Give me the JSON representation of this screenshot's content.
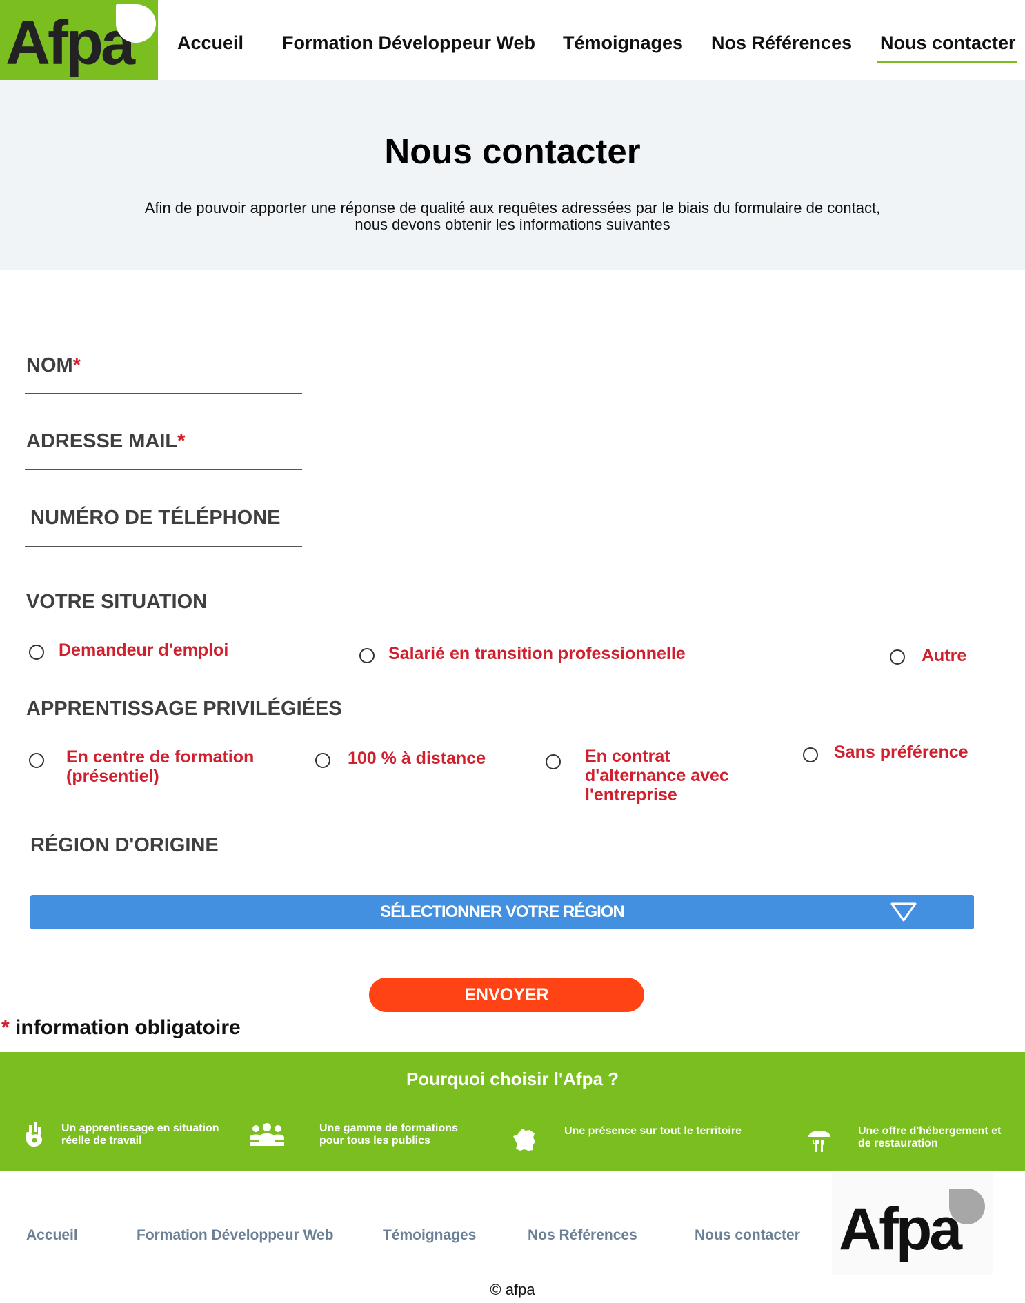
{
  "header": {
    "logo_text": "Afpa",
    "nav": [
      "Accueil",
      "Formation Développeur Web",
      "Témoignages",
      "Nos Références",
      "Nous contacter"
    ],
    "active_nav": "Nous contacter"
  },
  "hero": {
    "title": "Nous contacter",
    "subtitle_line1": "Afin de pouvoir apporter une réponse de qualité aux requêtes adressées par le biais du formulaire de contact,",
    "subtitle_line2": "nous devons obtenir les informations suivantes"
  },
  "form": {
    "nom_label": "NOM",
    "mail_label": "ADRESSE MAIL",
    "tel_label": "NUMÉRO DE TÉLÉPHONE",
    "required_mark": "*",
    "situation_label": "VOTRE SITUATION",
    "situation_options": [
      "Demandeur d'emploi",
      "Salarié en transition professionnelle",
      "Autre"
    ],
    "apprentissage_label": "APPRENTISSAGE PRIVILÉGIÉES",
    "apprentissage_options": [
      "En centre de formation (présentiel)",
      "100 % à distance",
      "En contrat d'alternance avec l'entreprise",
      "Sans préférence"
    ],
    "region_label": "RÉGION D'ORIGINE",
    "region_select": "SÉLECTIONNER VOTRE RÉGION",
    "submit_label": "ENVOYER",
    "mandatory_note": "information obligatoire"
  },
  "why": {
    "title": "Pourquoi choisir l'Afpa ?",
    "features": [
      {
        "icon": "hand-ok-icon",
        "text": "Un apprentissage en situation réelle de travail"
      },
      {
        "icon": "people-group-icon",
        "text": "Une gamme de formations pour tous les publics"
      },
      {
        "icon": "france-map-icon",
        "text": "Une présence sur tout le territoire"
      },
      {
        "icon": "restaurant-icon",
        "text": "Une offre d'hébergement et de restauration"
      }
    ]
  },
  "footer": {
    "links": [
      "Accueil",
      "Formation Développeur Web",
      "Témoignages",
      "Nos Références",
      "Nous contacter"
    ],
    "logo_text": "Afpa",
    "copyright": "© afpa"
  },
  "colors": {
    "brand_green": "#7ABF1F",
    "required_red": "#D0202E",
    "select_blue": "#4490E0",
    "submit_orange": "#FF4314",
    "hero_bg": "#F0F4F7",
    "footer_link": "#6B8096"
  }
}
